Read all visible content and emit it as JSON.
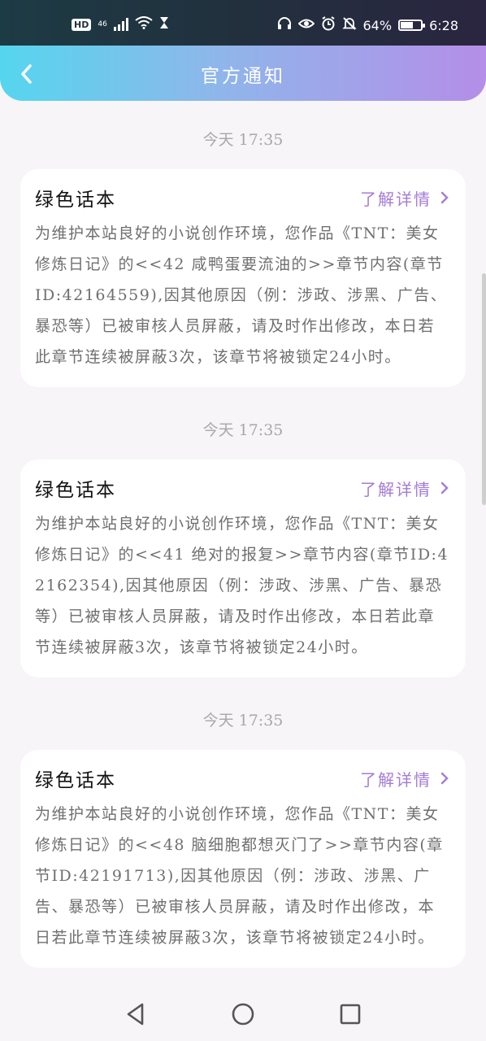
{
  "status_bar": {
    "network_badge": "HD",
    "network_type": "46",
    "battery_percent": "64%",
    "time": "6:28",
    "battery_level": 0.64
  },
  "header": {
    "back_icon": "chevron-left-icon",
    "title": "官方通知"
  },
  "messages": [
    {
      "timestamp": "今天 17:35",
      "title": "绿色话本",
      "link_label": "了解详情",
      "body": "为维护本站良好的小说创作环境，您作品《TNT：美女修炼日记》的<<42 咸鸭蛋要流油的>>章节内容(章节ID:42164559),因其他原因（例：涉政、涉黑、广告、暴恐等）已被审核人员屏蔽，请及时作出修改，本日若此章节连续被屏蔽3次，该章节将被锁定24小时。"
    },
    {
      "timestamp": "今天 17:35",
      "title": "绿色话本",
      "link_label": "了解详情",
      "body": "为维护本站良好的小说创作环境，您作品《TNT：美女修炼日记》的<<41 绝对的报复>>章节内容(章节ID:42162354),因其他原因（例：涉政、涉黑、广告、暴恐等）已被审核人员屏蔽，请及时作出修改，本日若此章节连续被屏蔽3次，该章节将被锁定24小时。"
    },
    {
      "timestamp": "今天 17:35",
      "title": "绿色话本",
      "link_label": "了解详情",
      "body": "为维护本站良好的小说创作环境，您作品《TNT：美女修炼日记》的<<48 脑细胞都想灭门了>>章节内容(章节ID:42191713),因其他原因（例：涉政、涉黑、广告、暴恐等）已被审核人员屏蔽，请及时作出修改，本日若此章节连续被屏蔽3次，该章节将被锁定24小时。"
    }
  ],
  "bottom_nav": {
    "back_icon": "triangle-back-icon",
    "home_icon": "circle-home-icon",
    "recents_icon": "square-recents-icon"
  },
  "colors": {
    "accent": "#a37cd6",
    "header_start": "#55d6ee",
    "header_end": "#b48ee8"
  }
}
